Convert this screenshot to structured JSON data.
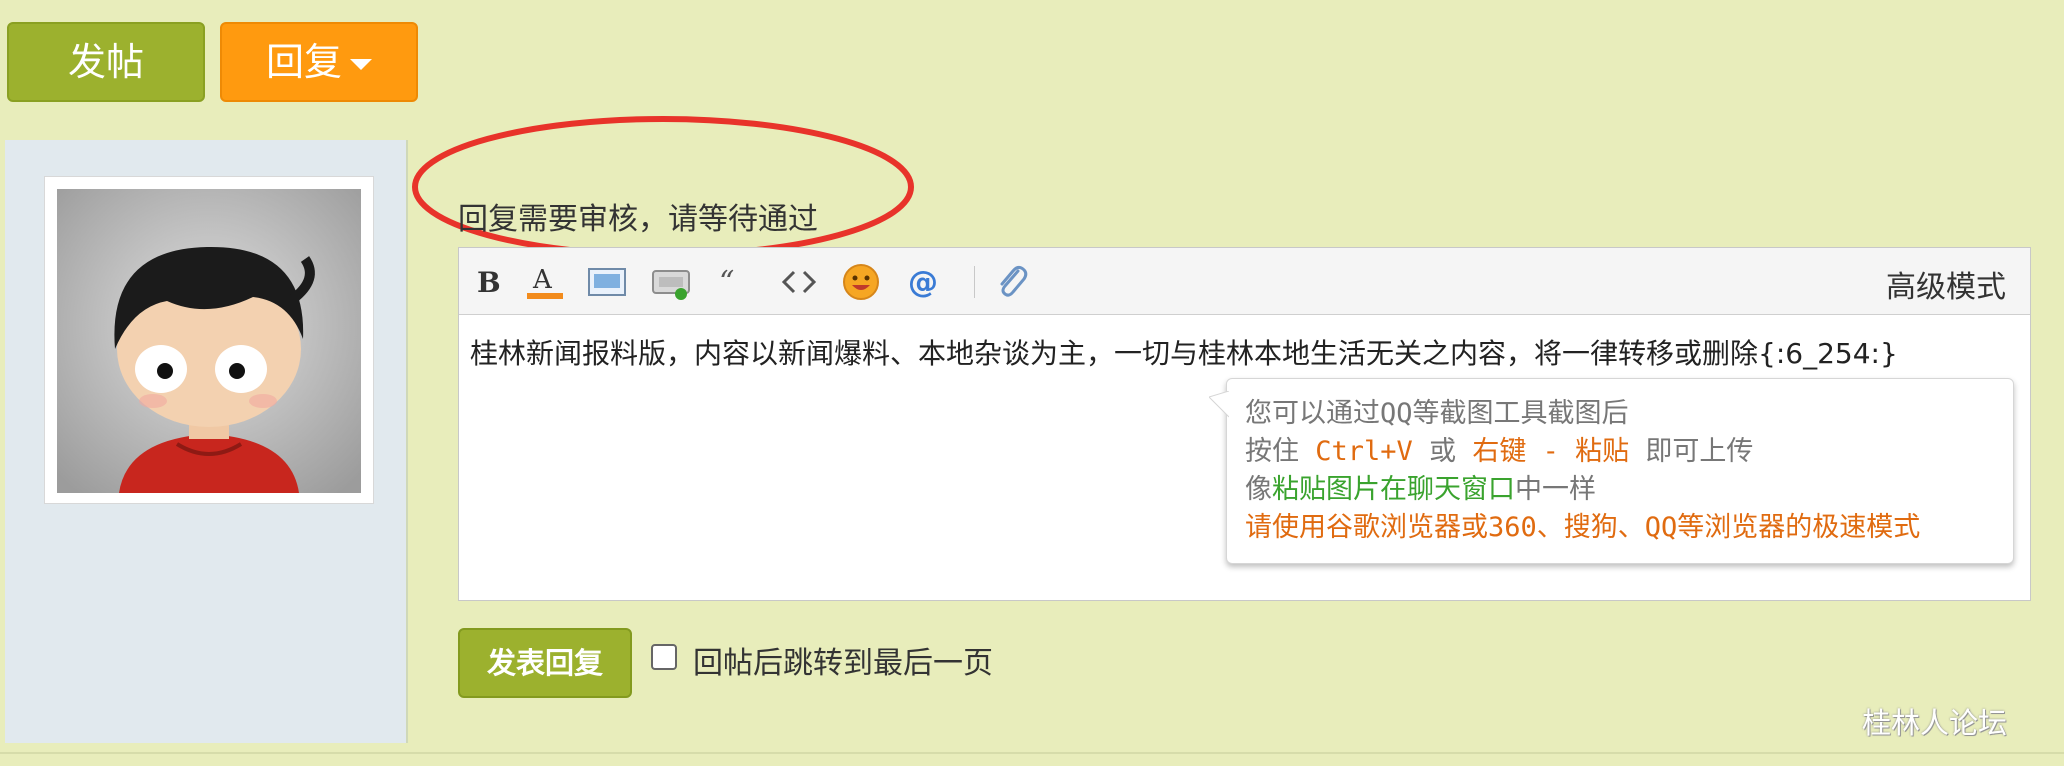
{
  "actions": {
    "post_label": "发帖",
    "reply_label": "回复"
  },
  "notice": "回复需要审核，请等待通过",
  "editor": {
    "toolbar_icons": [
      "bold-icon",
      "font-color-icon",
      "image-icon",
      "attach-image-icon",
      "quote-icon",
      "code-icon",
      "emoji-icon",
      "mention-icon",
      "attachment-icon"
    ],
    "advanced_mode_label": "高级模式",
    "content": "桂林新闻报料版，内容以新闻爆料、本地杂谈为主，一切与桂林本地生活无关之内容，将一律转移或删除{:6_254:}"
  },
  "paste_tip": {
    "line1": "您可以通过QQ等截图工具截图后",
    "line2_a": "按住 ",
    "line2_b": "Ctrl+V",
    "line2_c": " 或 ",
    "line2_d": "右键 - 粘贴",
    "line2_e": " 即可上传",
    "line3_a": "像",
    "line3_b": "粘贴图片在聊天窗口",
    "line3_c": "中一样",
    "line4": "请使用谷歌浏览器或360、搜狗、QQ等浏览器的极速模式"
  },
  "submit_label": "发表回复",
  "jump_checkbox": {
    "label": "回帖后跳转到最后一页",
    "checked": false
  },
  "watermark": "桂林人论坛",
  "colors": {
    "page_bg": "#e8edbb",
    "green_button": "#9cb12e",
    "orange_button": "#ff9a0f",
    "annotation_red": "#e8332a"
  }
}
